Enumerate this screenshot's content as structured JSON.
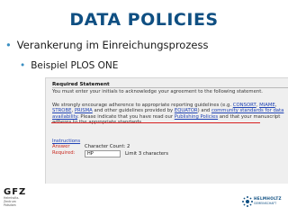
{
  "slide": {
    "title": "DATA POLICIES",
    "bullet_1": "Verankerung im Einreichungsprozess",
    "bullet_2": "Beispiel PLOS ONE"
  },
  "form": {
    "heading": "Required Statement",
    "acknowledge": "You must enter your initials to acknowledge your agreement to the following statement.",
    "para_a": "We strongly encourage adherence to appropriate reporting guidelines (e.g. ",
    "link_consort": "CONSORT",
    "sep_1": ",",
    "link_miame": "MIAME",
    "sep_2": ", ",
    "link_strobe": "STROBE",
    "sep_3": ", ",
    "link_prisma": "PRISMA",
    "para_b": " and other guidelines provided by ",
    "link_equator": "EQUATOR",
    "para_c": ") and ",
    "link_community": "community standards for data availability",
    "para_d": ". Please indicate that you have read our ",
    "link_publishing": "Publishing Policies",
    "para_e": " and that your manuscript adheres to the appropriate standards.",
    "instructions": "Instructions",
    "answer": "Answer",
    "required": "Required:",
    "char_count": "Character Count: 2",
    "input_value": "HP",
    "limit": "Limit 3 characters"
  },
  "logos": {
    "gfz": "GFZ",
    "gfz_sub_1": "Helmholtz-Zentrum",
    "gfz_sub_2": "Potsdam",
    "helmholtz": "HELMHOLTZ",
    "helmholtz_sub": "GEMEINSCHAFT"
  },
  "colors": {
    "title": "#0f4f82",
    "bullet_dot": "#3a8fc2",
    "link": "#1f43b5",
    "answer_red": "#c8261c",
    "underline_mark": "#d81f1f"
  }
}
